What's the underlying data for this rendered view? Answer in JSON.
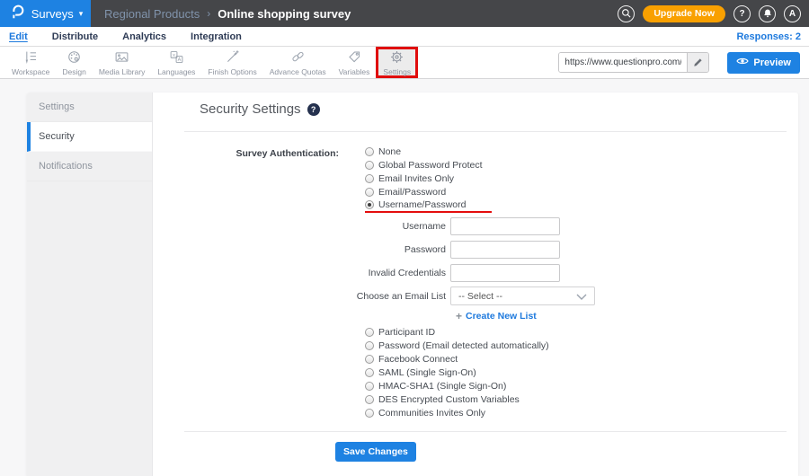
{
  "topbar": {
    "product": "Surveys",
    "caret": "▾",
    "breadcrumb_parent": "Regional Products",
    "breadcrumb_sep": "›",
    "breadcrumb_current": "Online shopping survey",
    "upgrade": "Upgrade Now",
    "help_glyph": "?",
    "avatar_initial": "A"
  },
  "subnav": {
    "items": [
      {
        "label": "Edit"
      },
      {
        "label": "Distribute"
      },
      {
        "label": "Analytics"
      },
      {
        "label": "Integration"
      }
    ],
    "responses": "Responses: 2"
  },
  "toolbar": {
    "items": [
      {
        "label": "Workspace"
      },
      {
        "label": "Design"
      },
      {
        "label": "Media Library"
      },
      {
        "label": "Languages"
      },
      {
        "label": "Finish Options"
      },
      {
        "label": "Advance Quotas"
      },
      {
        "label": "Variables"
      },
      {
        "label": "Settings"
      }
    ],
    "url": "https://www.questionpro.com/t/APNrFZ",
    "preview": "Preview"
  },
  "sidebar": {
    "items": [
      {
        "label": "Settings"
      },
      {
        "label": "Security"
      },
      {
        "label": "Notifications"
      }
    ]
  },
  "content": {
    "title": "Security Settings",
    "help_glyph": "?",
    "auth_label": "Survey Authentication:",
    "auth_top": [
      {
        "label": "None"
      },
      {
        "label": "Global Password Protect"
      },
      {
        "label": "Email Invites Only"
      },
      {
        "label": "Email/Password"
      },
      {
        "label": "Username/Password",
        "selected": true
      }
    ],
    "fields": [
      {
        "label": "Username",
        "value": ""
      },
      {
        "label": "Password",
        "value": ""
      },
      {
        "label": "Invalid Credentials",
        "value": ""
      }
    ],
    "email_list_label": "Choose an Email List",
    "email_list_value": "-- Select --",
    "create_new_plus": "+",
    "create_new": "Create New List",
    "auth_bottom": [
      {
        "label": "Participant ID"
      },
      {
        "label": "Password (Email detected automatically)"
      },
      {
        "label": "Facebook Connect"
      },
      {
        "label": "SAML (Single Sign-On)"
      },
      {
        "label": "HMAC-SHA1 (Single Sign-On)"
      },
      {
        "label": "DES Encrypted Custom Variables"
      },
      {
        "label": "Communities Invites Only"
      }
    ],
    "save": "Save Changes"
  },
  "colors": {
    "accent_blue": "#1e82e2",
    "upgrade_orange": "#f9a000",
    "annotation_red": "#e00d0d",
    "topbar_bg": "#454649"
  }
}
